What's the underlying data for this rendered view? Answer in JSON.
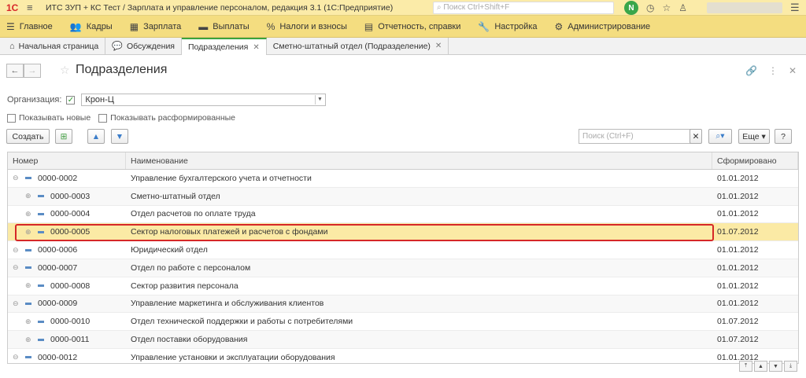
{
  "titlebar": {
    "logo": "1С",
    "title": "ИТС ЗУП + КС Тест / Зарплата и управление персоналом, редакция 3.1  (1С:Предприятие)",
    "search_placeholder": "Поиск Ctrl+Shift+F"
  },
  "sections": [
    {
      "label": "Главное",
      "icon": "menu-icon"
    },
    {
      "label": "Кадры",
      "icon": "people-icon"
    },
    {
      "label": "Зарплата",
      "icon": "calculator-icon"
    },
    {
      "label": "Выплаты",
      "icon": "wallet-icon"
    },
    {
      "label": "Налоги и взносы",
      "icon": "percent-icon"
    },
    {
      "label": "Отчетность, справки",
      "icon": "document-icon"
    },
    {
      "label": "Настройка",
      "icon": "wrench-icon"
    },
    {
      "label": "Администрирование",
      "icon": "gear-icon"
    }
  ],
  "tabs": [
    {
      "label": "Начальная страница",
      "icon": "home-icon"
    },
    {
      "label": "Обсуждения",
      "icon": "chat-icon"
    },
    {
      "label": "Подразделения",
      "closable": true,
      "active": true
    },
    {
      "label": "Сметно-штатный отдел (Подразделение)",
      "closable": true
    }
  ],
  "page": {
    "title": "Подразделения"
  },
  "filters": {
    "org_label": "Организация:",
    "org_value": "Крон-Ц",
    "show_new": "Показывать новые",
    "show_disbanded": "Показывать расформированные"
  },
  "toolbar": {
    "create_label": "Создать",
    "search_placeholder": "Поиск (Ctrl+F)",
    "more_label": "Еще",
    "help_label": "?"
  },
  "grid": {
    "columns": [
      "Номер",
      "Наименование",
      "Сформировано"
    ],
    "rows": [
      {
        "number": "0000-0002",
        "name": "Управление бухгалтерского учета и отчетности",
        "date": "01.01.2012",
        "level": 0
      },
      {
        "number": "0000-0003",
        "name": "Сметно-штатный отдел",
        "date": "01.01.2012",
        "level": 1
      },
      {
        "number": "0000-0004",
        "name": "Отдел расчетов по оплате труда",
        "date": "01.01.2012",
        "level": 1
      },
      {
        "number": "0000-0005",
        "name": "Сектор налоговых платежей и расчетов с фондами",
        "date": "01.07.2012",
        "level": 1,
        "selected": true
      },
      {
        "number": "0000-0006",
        "name": "Юридический отдел",
        "date": "01.01.2012",
        "level": 0
      },
      {
        "number": "0000-0007",
        "name": "Отдел по работе с персоналом",
        "date": "01.01.2012",
        "level": 0
      },
      {
        "number": "0000-0008",
        "name": "Сектор развития персонала",
        "date": "01.01.2012",
        "level": 1
      },
      {
        "number": "0000-0009",
        "name": "Управление маркетинга и обслуживания клиентов",
        "date": "01.01.2012",
        "level": 0
      },
      {
        "number": "0000-0010",
        "name": "Отдел технической поддержки и работы с потребителями",
        "date": "01.07.2012",
        "level": 1
      },
      {
        "number": "0000-0011",
        "name": "Отдел поставки оборудования",
        "date": "01.07.2012",
        "level": 1
      },
      {
        "number": "0000-0012",
        "name": "Управление установки и эксплуатации оборудования",
        "date": "01.01.2012",
        "level": 0
      }
    ]
  },
  "colors": {
    "titlebar_bg": "#fbeba8",
    "sections_bg": "#f4dd80",
    "selected_row": "#fbeaa5",
    "highlight_border": "#d62727",
    "accent_green": "#3ca33c"
  }
}
